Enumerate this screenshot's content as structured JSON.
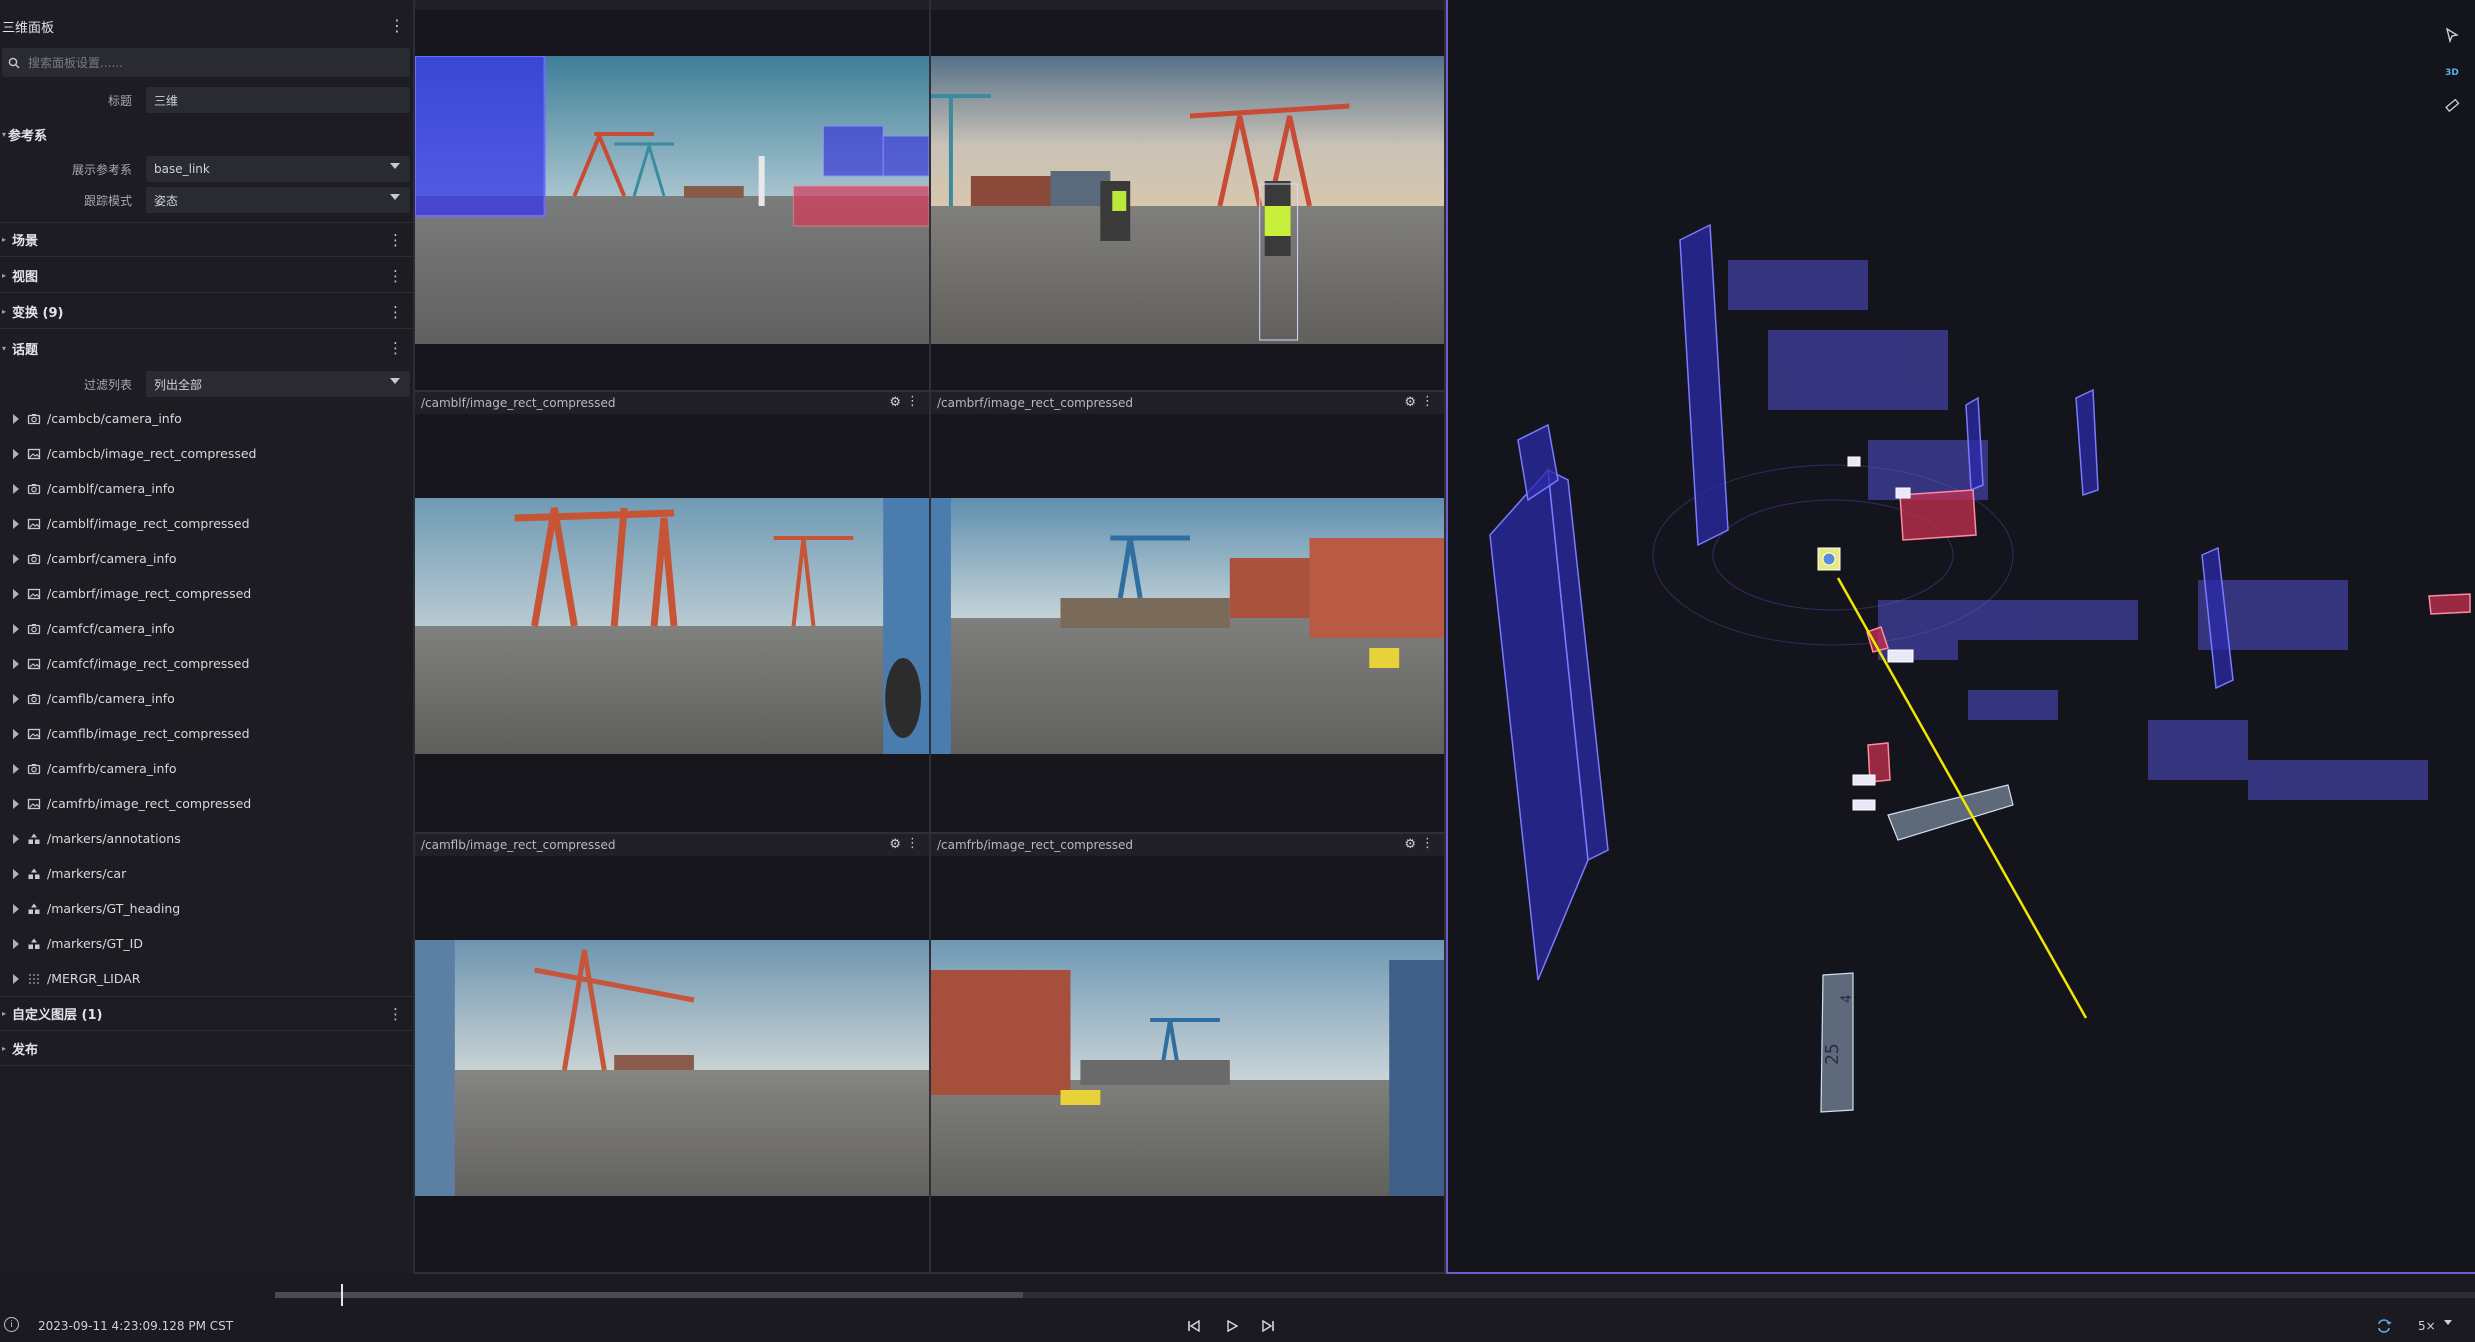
{
  "sidebar": {
    "title": "三维面板",
    "search_placeholder": "搜索面板设置......",
    "title_field": {
      "label": "标题",
      "value": "三维"
    },
    "frame_section": "参考系",
    "display_frame": {
      "label": "展示参考系",
      "value": "base_link"
    },
    "follow_mode": {
      "label": "跟踪模式",
      "value": "姿态"
    },
    "sections": {
      "scene": "场景",
      "view": "视图",
      "transforms": "变换 (9)",
      "topics": "话题",
      "custom_layers": "自定义图层 (1)",
      "publish": "发布"
    },
    "filter": {
      "label": "过滤列表",
      "value": "列出全部"
    },
    "topics": [
      {
        "name": "/cambcb/camera_info",
        "icon": "camera-icon"
      },
      {
        "name": "/cambcb/image_rect_compressed",
        "icon": "image-icon"
      },
      {
        "name": "/camblf/camera_info",
        "icon": "camera-icon"
      },
      {
        "name": "/camblf/image_rect_compressed",
        "icon": "image-icon"
      },
      {
        "name": "/cambrf/camera_info",
        "icon": "camera-icon"
      },
      {
        "name": "/cambrf/image_rect_compressed",
        "icon": "image-icon"
      },
      {
        "name": "/camfcf/camera_info",
        "icon": "camera-icon"
      },
      {
        "name": "/camfcf/image_rect_compressed",
        "icon": "image-icon"
      },
      {
        "name": "/camflb/camera_info",
        "icon": "camera-icon"
      },
      {
        "name": "/camflb/image_rect_compressed",
        "icon": "image-icon"
      },
      {
        "name": "/camfrb/camera_info",
        "icon": "camera-icon"
      },
      {
        "name": "/camfrb/image_rect_compressed",
        "icon": "image-icon"
      },
      {
        "name": "/markers/annotations",
        "icon": "markers-icon"
      },
      {
        "name": "/markers/car",
        "icon": "markers-icon"
      },
      {
        "name": "/markers/GT_heading",
        "icon": "markers-icon"
      },
      {
        "name": "/markers/GT_ID",
        "icon": "markers-icon"
      },
      {
        "name": "/MERGR_LIDAR",
        "icon": "pointcloud-icon"
      }
    ]
  },
  "cameras": {
    "top_left": "",
    "top_right": "",
    "mid_left": "/camblf/image_rect_compressed",
    "mid_right": "/cambrf/image_rect_compressed",
    "bot_left": "/camflb/image_rect_compressed",
    "bot_right": "/camfrb/image_rect_compressed"
  },
  "view3d": {
    "mode_badge": "3D",
    "box_label_a": "25",
    "box_label_b": "4"
  },
  "playback": {
    "timestamp": "2023-09-11 4:23:09.128 PM CST",
    "speed": "5×",
    "progress": 0.34,
    "buffered": 0.34
  },
  "colors": {
    "accent": "#6c5fc7",
    "box_blue": "#3a3ae0",
    "box_red": "#d83a5a",
    "trajectory": "#f2e600"
  }
}
